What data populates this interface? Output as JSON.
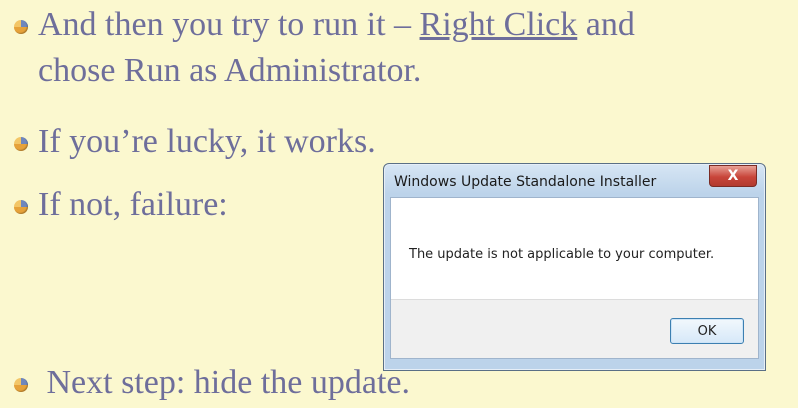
{
  "bullets": [
    {
      "prefix": "And then you try to run it – ",
      "link": "Right Click",
      "suffix": " and\nchose Run as Administrator."
    },
    {
      "text": "If you’re lucky, it works."
    },
    {
      "text": "If not, failure:"
    },
    {
      "text": " Next step: hide the update."
    }
  ],
  "dialog": {
    "title": "Windows Update Standalone Installer",
    "close_label": "X",
    "message": "The update is not applicable to your computer.",
    "ok_label": "OK"
  },
  "icons": {
    "bullet": "bullet-ball-icon",
    "close": "close-icon"
  },
  "colors": {
    "background": "#fbf8cf",
    "text": "#6e6e9b"
  }
}
